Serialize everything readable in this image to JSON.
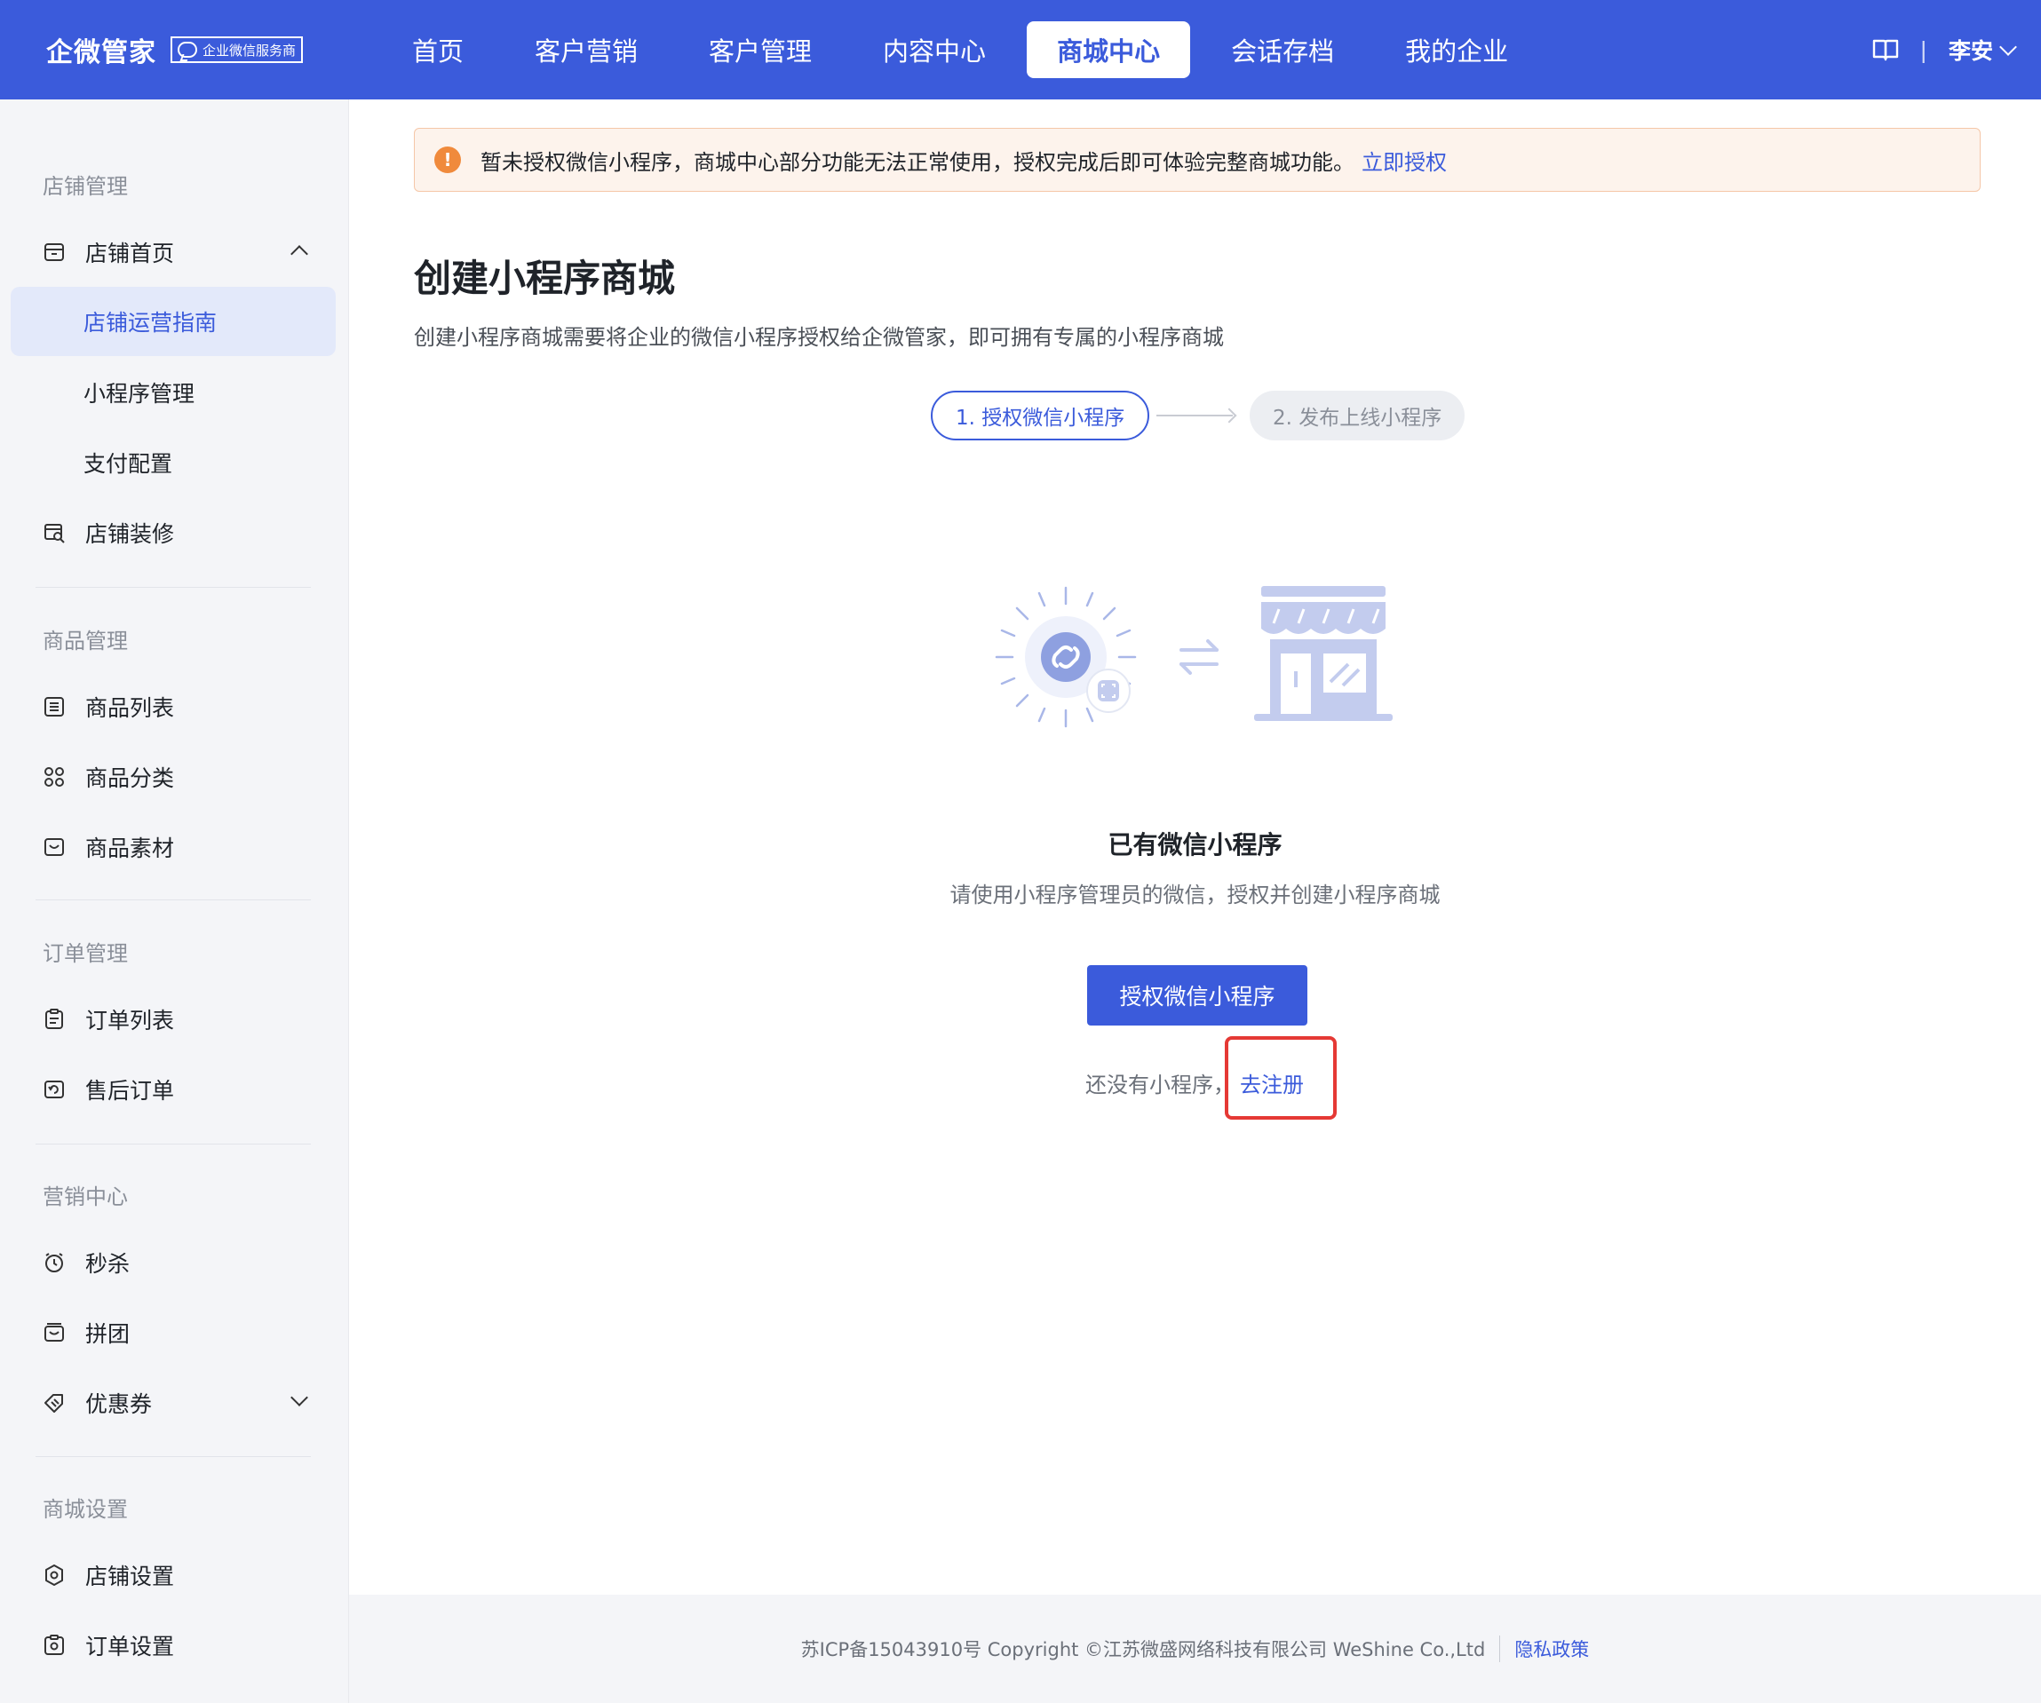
{
  "header": {
    "brand": "企微管家",
    "badge": "企业微信服务商",
    "tabs": [
      {
        "label": "首页"
      },
      {
        "label": "客户营销"
      },
      {
        "label": "客户管理"
      },
      {
        "label": "内容中心"
      },
      {
        "label": "商城中心"
      },
      {
        "label": "会话存档"
      },
      {
        "label": "我的企业"
      }
    ],
    "active_tab": "商城中心",
    "separator": "|",
    "user": "李安",
    "accent": "#3b5bdb"
  },
  "sidebar": {
    "sections": [
      {
        "title": "店铺管理"
      },
      {
        "title": "商品管理"
      },
      {
        "title": "订单管理"
      },
      {
        "title": "营销中心"
      },
      {
        "title": "商城设置"
      }
    ],
    "items": {
      "store_home": "店铺首页",
      "store_guide": "店铺运营指南",
      "miniapp_manage": "小程序管理",
      "payment_config": "支付配置",
      "store_decor": "店铺装修",
      "product_list": "商品列表",
      "product_category": "商品分类",
      "product_material": "商品素材",
      "order_list": "订单列表",
      "after_sale": "售后订单",
      "flash_sale": "秒杀",
      "group_buy": "拼团",
      "coupon": "优惠券",
      "store_settings": "店铺设置",
      "order_settings": "订单设置"
    }
  },
  "alert": {
    "text": "暂未授权微信小程序，商城中心部分功能无法正常使用，授权完成后即可体验完整商城功能。",
    "link": "立即授权"
  },
  "main": {
    "title": "创建小程序商城",
    "description": "创建小程序商城需要将企业的微信小程序授权给企微管家，即可拥有专属的小程序商城",
    "steps": [
      "1. 授权微信小程序",
      "2. 发布上线小程序"
    ],
    "section_title": "已有微信小程序",
    "section_sub": "请使用小程序管理员的微信，授权并创建小程序商城",
    "auth_button": "授权微信小程序",
    "no_app_text": "还没有小程序，",
    "register_link": "去注册"
  },
  "footer": {
    "text": "苏ICP备15043910号 Copyright ©江苏微盛网络科技有限公司 WeShine Co.,Ltd",
    "privacy": "隐私政策"
  }
}
